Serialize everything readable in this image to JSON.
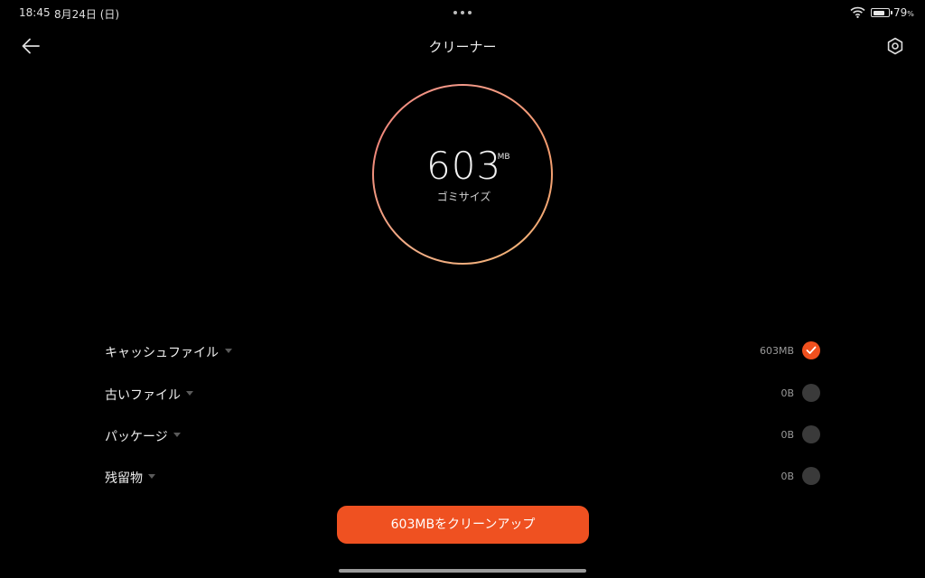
{
  "status_bar": {
    "time": "18:45",
    "date": "8月24日 (日)",
    "battery_level": "79",
    "battery_unit": "%",
    "battery_fraction": 0.79
  },
  "header": {
    "title": "クリーナー",
    "back_icon": "arrow-left-icon",
    "settings_icon": "settings-hexagon-icon"
  },
  "summary": {
    "value": "603",
    "unit": "MB",
    "label": "ゴミサイズ"
  },
  "categories": [
    {
      "label": "キャッシュファイル",
      "size": "603MB",
      "checked": true
    },
    {
      "label": "古いファイル",
      "size": "0B",
      "checked": false
    },
    {
      "label": "パッケージ",
      "size": "0B",
      "checked": false
    },
    {
      "label": "残留物",
      "size": "0B",
      "checked": false
    }
  ],
  "action": {
    "button_label": "603MBをクリーンアップ"
  },
  "colors": {
    "accent": "#ef5121",
    "background": "#000000",
    "ring_gradient": [
      "#f49a8a",
      "#f2b077",
      "#f0877a"
    ]
  }
}
